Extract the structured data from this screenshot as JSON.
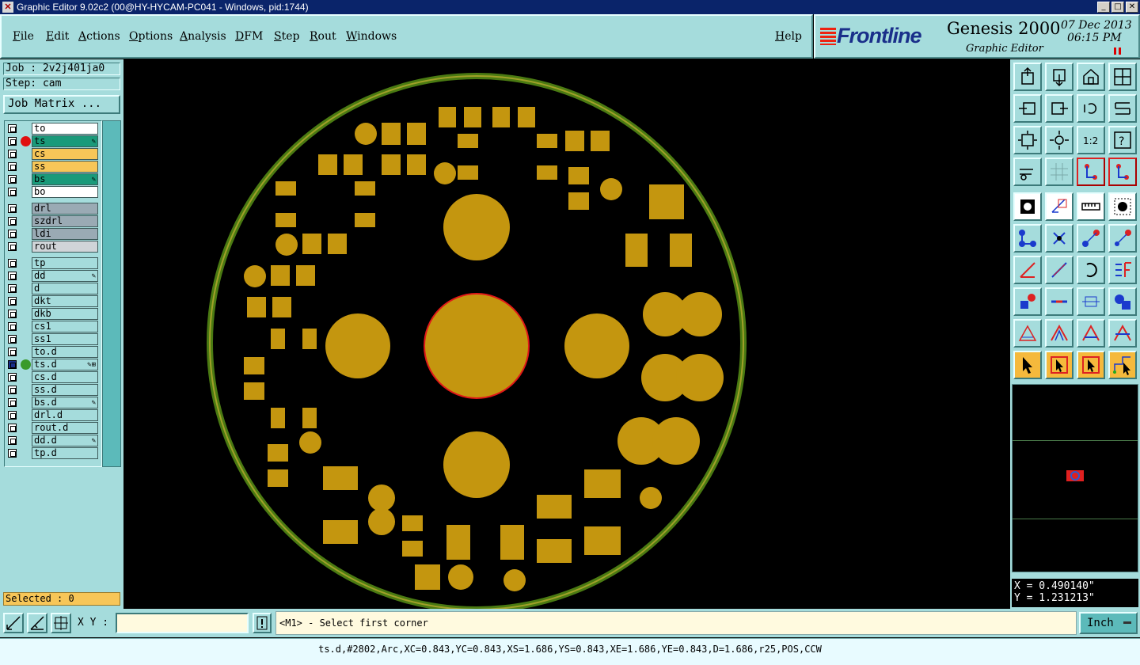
{
  "window": {
    "title": "Graphic Editor 9.02c2 (00@HY-HYCAM-PC041 - Windows, pid:1744)",
    "buttons": [
      "_",
      "□",
      "✕"
    ]
  },
  "menu": [
    "File",
    "Edit",
    "Actions",
    "Options",
    "Analysis",
    "DFM",
    "Step",
    "Rout",
    "Windows",
    "Help"
  ],
  "brand": {
    "logo": "Frontline",
    "product": "Genesis 2000",
    "subtitle": "Graphic Editor",
    "date": "07 Dec 2013",
    "time": "06:15 PM"
  },
  "job": {
    "job_label": "Job : 2v2j401ja0",
    "step_label": "Step: cam",
    "matrix_button": "Job Matrix ..."
  },
  "layers": [
    {
      "name": "to",
      "color": "#ffffff"
    },
    {
      "name": "ts",
      "color": "#1a9a7a",
      "dot": "#e01010",
      "mark": "✎"
    },
    {
      "name": "cs",
      "color": "#f7c658"
    },
    {
      "name": "ss",
      "color": "#f7c658"
    },
    {
      "name": "bs",
      "color": "#1a9a7a",
      "mark": "✎"
    },
    {
      "name": "bo",
      "color": "#ffffff"
    },
    {
      "name": "drl",
      "color": "#9aaab4"
    },
    {
      "name": "szdrl",
      "color": "#9aaab4"
    },
    {
      "name": "ldi",
      "color": "#9aaab4"
    },
    {
      "name": "rout",
      "color": "#d0d4d8"
    },
    {
      "name": "tp",
      "color": "#a5dcdc"
    },
    {
      "name": "dd",
      "color": "#a5dcdc",
      "mark": "✎"
    },
    {
      "name": "d",
      "color": "#a5dcdc"
    },
    {
      "name": "dkt",
      "color": "#a5dcdc"
    },
    {
      "name": "dkb",
      "color": "#a5dcdc"
    },
    {
      "name": "cs1",
      "color": "#a5dcdc"
    },
    {
      "name": "ss1",
      "color": "#a5dcdc"
    },
    {
      "name": "to.d",
      "color": "#a5dcdc"
    },
    {
      "name": "ts.d",
      "color": "#a5dcdc",
      "dot": "#3a9a2a",
      "mark": "✎⊞",
      "work": true
    },
    {
      "name": "cs.d",
      "color": "#a5dcdc"
    },
    {
      "name": "ss.d",
      "color": "#a5dcdc"
    },
    {
      "name": "bs.d",
      "color": "#a5dcdc",
      "mark": "✎"
    },
    {
      "name": "drl.d",
      "color": "#a5dcdc"
    },
    {
      "name": "rout.d",
      "color": "#a5dcdc"
    },
    {
      "name": "dd.d",
      "color": "#a5dcdc",
      "mark": "✎"
    },
    {
      "name": "tp.d",
      "color": "#a5dcdc"
    }
  ],
  "selected": "Selected : 0",
  "coords": {
    "x": "X = 0.490140\"",
    "y": "Y = 1.231213\""
  },
  "command": {
    "xy_label": "X Y :",
    "xy_value": "",
    "prompt": "<M1> - Select first corner",
    "units": "Inch"
  },
  "status_line": "ts.d,#2802,Arc,XC=0.843,YC=0.843,XS=1.686,YS=0.843,XE=1.686,YE=0.843,D=1.686,r25,POS,CCW",
  "colors": {
    "pad": "#c4960f",
    "ring_outer": "#6b8a16",
    "ring_inner": "#8aa020",
    "highlight": "#e01818",
    "panel": "#a5dcdc"
  },
  "tools": [
    "zoom-in-icon",
    "zoom-out-icon",
    "home-icon",
    "zoom-window-icon",
    "pan-left-icon",
    "pan-right-icon",
    "undo-view-icon",
    "redraw-icon",
    "fit-icon",
    "center-icon",
    "scale-1-2-icon",
    "help-icon",
    "snap-icon",
    "grid-icon",
    "connect-icon",
    "connect-alt-icon",
    "fill-icon",
    "outline-icon",
    "ruler-icon",
    "solid-icon",
    "net-icon",
    "cross-icon",
    "add-pad-icon",
    "move-pad-icon",
    "line-icon",
    "line-slope-icon",
    "arc-icon",
    "resize-icon",
    "pad-add-icon",
    "minus-icon",
    "measure-icon",
    "group-icon",
    "triangle-icon",
    "poly-icon",
    "poly-alt-icon",
    "poly-cross-icon",
    "select-icon",
    "select-box-icon",
    "select-red-icon",
    "select-path-icon"
  ]
}
